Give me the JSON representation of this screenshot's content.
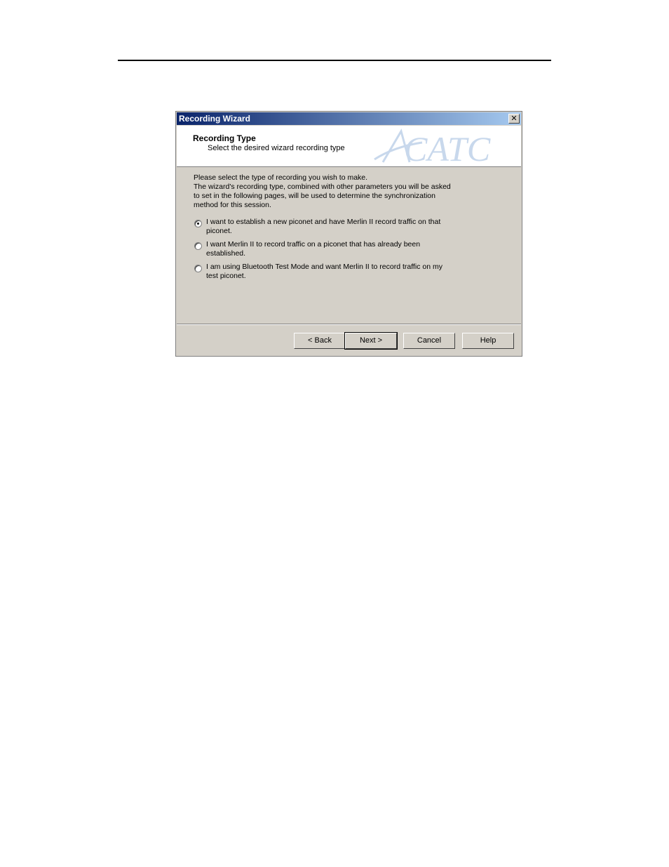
{
  "dialog": {
    "title": "Recording Wizard",
    "close_glyph": "✕",
    "header": {
      "title": "Recording Type",
      "subtitle": "Select the desired wizard recording type",
      "logo_text": "CATC"
    },
    "intro_lines": [
      "Please select the type of recording you wish to make.",
      "The wizard's recording type, combined with other parameters you will be asked",
      "to set in the following pages, will be used to determine the synchronization",
      "method for this session."
    ],
    "options": [
      {
        "lines": [
          "I want to establish a new piconet and have Merlin II record traffic on that",
          "piconet."
        ],
        "selected": true
      },
      {
        "lines": [
          "I want Merlin II to record traffic on a piconet that has already been",
          "established."
        ],
        "selected": false
      },
      {
        "lines": [
          "I am using Bluetooth Test Mode and want Merlin II to record traffic on my",
          "test piconet."
        ],
        "selected": false
      }
    ],
    "buttons": {
      "back": "< Back",
      "next": "Next >",
      "cancel": "Cancel",
      "help": "Help"
    }
  }
}
